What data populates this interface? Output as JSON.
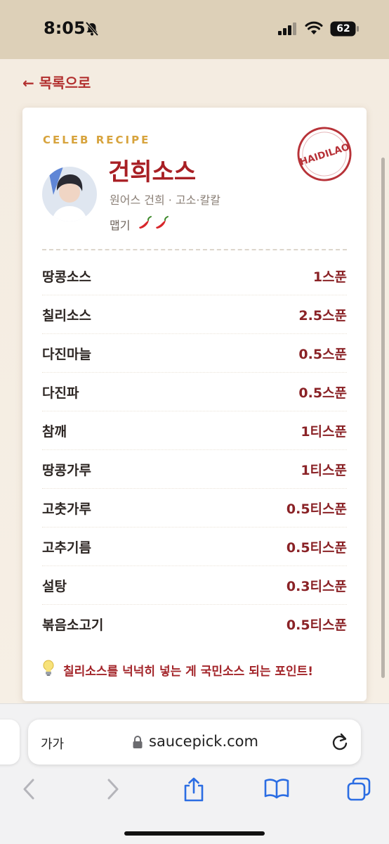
{
  "status_bar": {
    "time": "8:05",
    "battery": "62"
  },
  "nav": {
    "back_label": "← 목록으로"
  },
  "card": {
    "eyebrow": "CELEB RECIPE",
    "stamp_text": "HAIDILAO",
    "title": "건희소스",
    "subtitle": "원어스 건희 · 고소·칼칼",
    "spice_label": "맵기",
    "spice_level": 2,
    "ingredients": [
      {
        "name": "땅콩소스",
        "amount": "1스푼"
      },
      {
        "name": "칠리소스",
        "amount": "2.5스푼"
      },
      {
        "name": "다진마늘",
        "amount": "0.5스푼"
      },
      {
        "name": "다진파",
        "amount": "0.5스푼"
      },
      {
        "name": "참깨",
        "amount": "1티스푼"
      },
      {
        "name": "땅콩가루",
        "amount": "1티스푼"
      },
      {
        "name": "고춧가루",
        "amount": "0.5티스푼"
      },
      {
        "name": "고추기름",
        "amount": "0.5티스푼"
      },
      {
        "name": "설탕",
        "amount": "0.3티스푼"
      },
      {
        "name": "볶음소고기",
        "amount": "0.5티스푼"
      }
    ],
    "tip": "칠리소스를 넉넉히 넣는 게 국민소스 되는 포인트!"
  },
  "browser": {
    "aa_label": "가가",
    "url": "saucepick.com"
  },
  "colors": {
    "accent": "#a81f24",
    "gold": "#d7a33c",
    "background": "#f5ede1",
    "status_bar": "#ddd0b8"
  },
  "icons": [
    "bell-slash-icon",
    "signal-icon",
    "wifi-icon",
    "battery-icon",
    "chili-pepper-icon",
    "lightbulb-icon",
    "lock-icon",
    "reload-icon",
    "back-icon",
    "forward-icon",
    "share-icon",
    "bookmarks-icon",
    "tabs-icon"
  ]
}
